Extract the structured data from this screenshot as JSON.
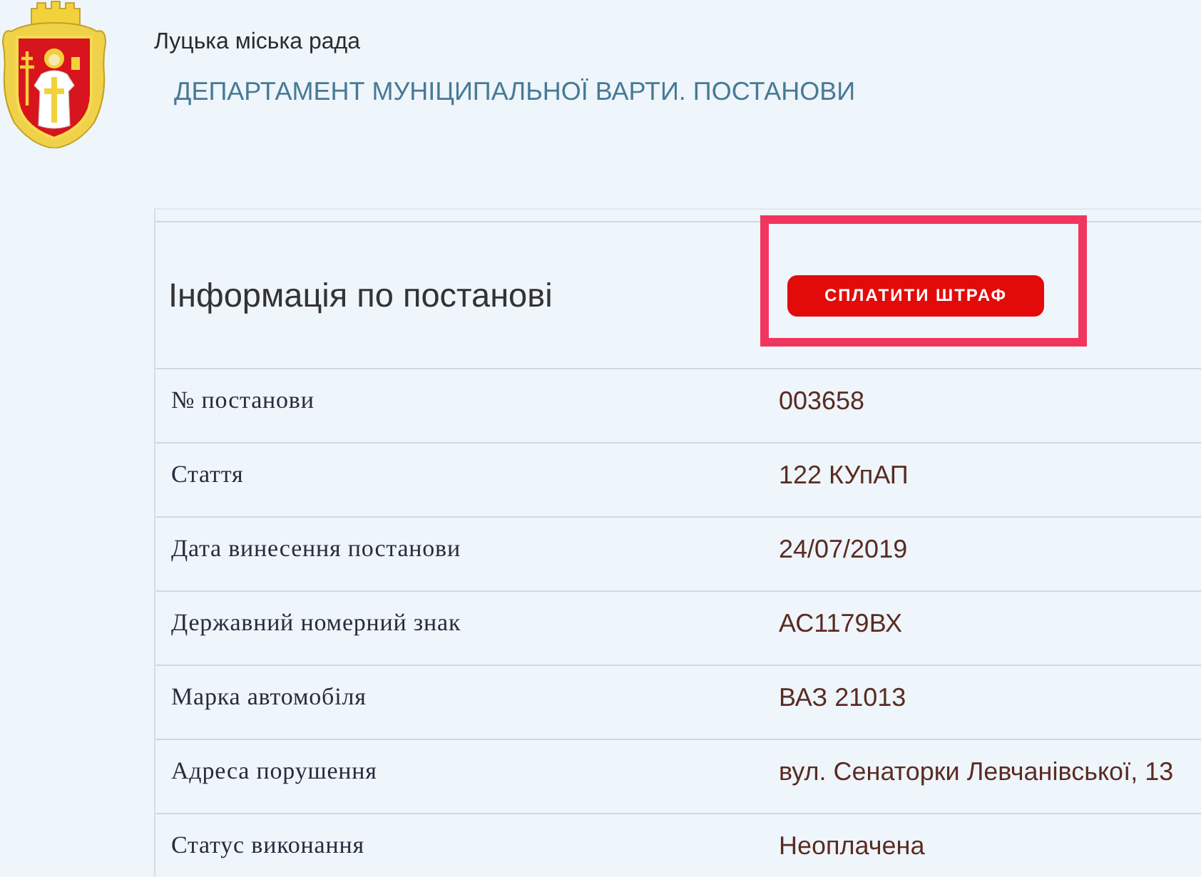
{
  "header": {
    "org": "Луцька міська рада",
    "title": "ДЕПАРТАМЕНТ МУНІЦИПАЛЬНОЇ ВАРТИ. ПОСТАНОВИ"
  },
  "panel": {
    "heading": "Інформація по постанові",
    "pay_button": {
      "label": "СПЛАТИТИ ШТРАФ",
      "highlighted": true
    },
    "rows": [
      {
        "label": "№ постанови",
        "value": "003658"
      },
      {
        "label": "Стаття",
        "value": "122 КУпАП"
      },
      {
        "label": "Дата винесення постанови",
        "value": "24/07/2019"
      },
      {
        "label": "Державний номерний знак",
        "value": "АС1179ВХ"
      },
      {
        "label": "Марка автомобіля",
        "value": "ВАЗ 21013"
      },
      {
        "label": "Адреса порушення",
        "value": "вул. Сенаторки Левчанівської, 13"
      },
      {
        "label": "Статус виконання",
        "value": "Неоплачена"
      }
    ]
  }
}
